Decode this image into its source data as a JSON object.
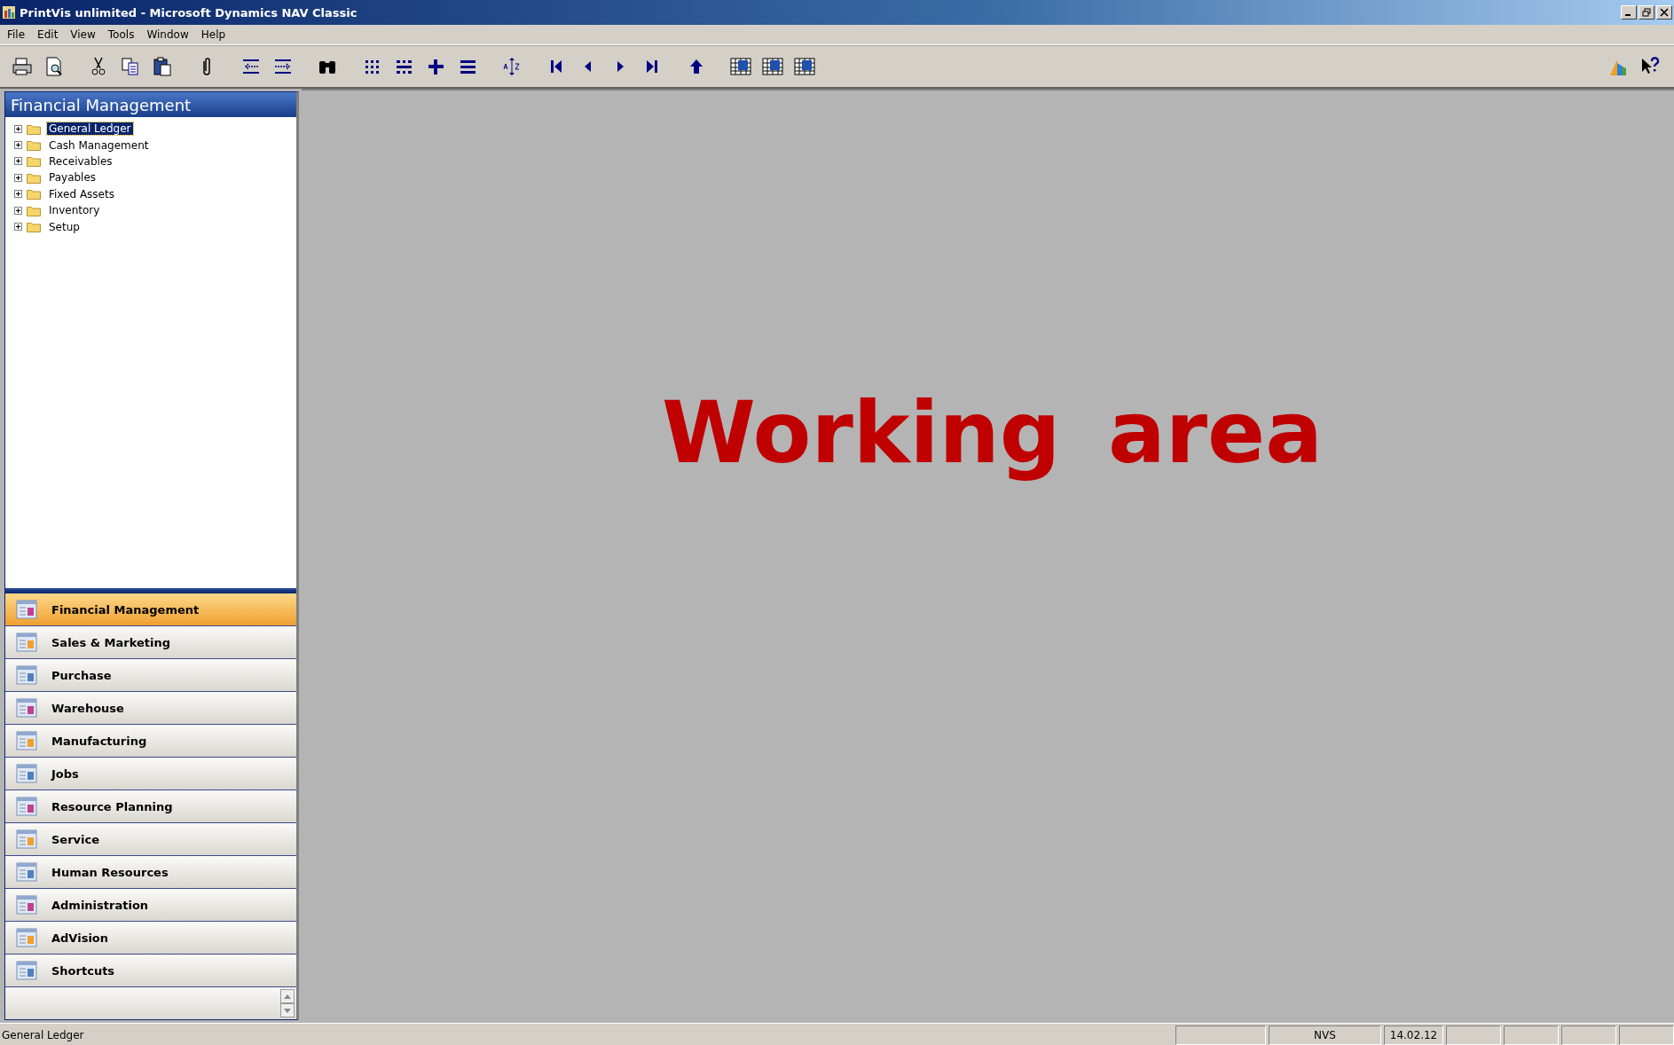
{
  "window": {
    "title": "PrintVis unlimited - Microsoft Dynamics NAV Classic"
  },
  "menu": [
    "File",
    "Edit",
    "View",
    "Tools",
    "Window",
    "Help"
  ],
  "navigation_pane": {
    "title": "Financial Management",
    "tree": [
      {
        "label": "General Ledger",
        "selected": true,
        "expanded": false
      },
      {
        "label": "Cash Management",
        "selected": false,
        "expanded": false
      },
      {
        "label": "Receivables",
        "selected": false,
        "expanded": false
      },
      {
        "label": "Payables",
        "selected": false,
        "expanded": false
      },
      {
        "label": "Fixed Assets",
        "selected": false,
        "expanded": false
      },
      {
        "label": "Inventory",
        "selected": false,
        "expanded": false
      },
      {
        "label": "Setup",
        "selected": false,
        "expanded": false
      }
    ],
    "buttons": [
      {
        "label": "Financial Management",
        "selected": true
      },
      {
        "label": "Sales & Marketing",
        "selected": false
      },
      {
        "label": "Purchase",
        "selected": false
      },
      {
        "label": "Warehouse",
        "selected": false
      },
      {
        "label": "Manufacturing",
        "selected": false
      },
      {
        "label": "Jobs",
        "selected": false
      },
      {
        "label": "Resource Planning",
        "selected": false
      },
      {
        "label": "Service",
        "selected": false
      },
      {
        "label": "Human Resources",
        "selected": false
      },
      {
        "label": "Administration",
        "selected": false
      },
      {
        "label": "AdVision",
        "selected": false
      },
      {
        "label": "Shortcuts",
        "selected": false
      }
    ]
  },
  "working_area": {
    "caption": "Working area"
  },
  "status_bar": {
    "message": "General Ledger",
    "user": "NVS",
    "date": "14.02.12"
  }
}
